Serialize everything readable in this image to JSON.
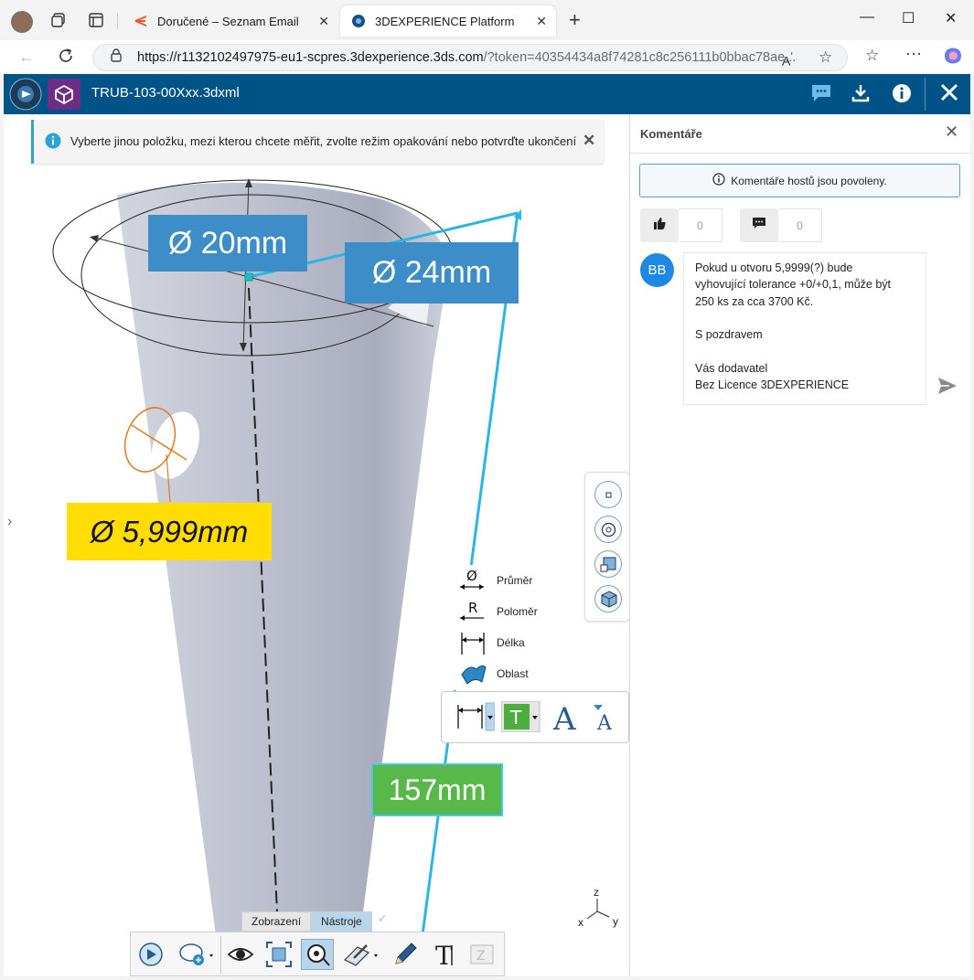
{
  "browser": {
    "tabs": [
      {
        "title": "Doručené – Seznam Email",
        "icon": "seznam-icon",
        "accent": "#e8572a"
      },
      {
        "title": "3DEXPERIENCE Platform",
        "icon": "3dexperience-icon",
        "active": true
      }
    ],
    "new_tab": "+",
    "url": "https://r1132102497975-eu1-scpres.3dexperience.3ds.com",
    "url_rest": "/?token=40354434a8f74281c8c256111b0bbac78ae...",
    "window": {
      "minimize": "—",
      "maximize": "☐",
      "close": "✕"
    }
  },
  "app": {
    "title": "TRUB-103-00Xxx.3dxml",
    "header_color": "#005386"
  },
  "viewer": {
    "info_message": "Vyberte jinou položku, mezi kterou chcete měřit, zvolte režim opakování nebo potvrďte ukončení",
    "dimensions": {
      "d20": "Ø 20mm",
      "d24": "Ø 24mm",
      "d5999": "Ø 5,999mm",
      "l157": "157mm"
    },
    "measure_menu": [
      {
        "label": "Průměr",
        "icon": "diameter-icon"
      },
      {
        "label": "Poloměr",
        "icon": "radius-icon"
      },
      {
        "label": "Délka",
        "icon": "length-icon"
      },
      {
        "label": "Oblast",
        "icon": "area-icon"
      }
    ],
    "bottom_tabs": [
      "Zobrazení",
      "Nástroje"
    ],
    "axes": {
      "z": "z",
      "x": "x",
      "y": "y"
    }
  },
  "comments": {
    "title": "Komentáře",
    "guest_notice": "Komentáře hostů jsou povoleny.",
    "likes": "0",
    "replies": "0",
    "avatar": "BB",
    "message": [
      "Pokud u otvoru 5,9999(?) bude",
      "vyhovující tolerance +0/+0,1, může být",
      "250 ks za cca 3700 Kč.",
      "",
      "S pozdravem",
      "",
      "Vás dodavatel",
      "Bez Licence 3DEXPERIENCE"
    ]
  }
}
